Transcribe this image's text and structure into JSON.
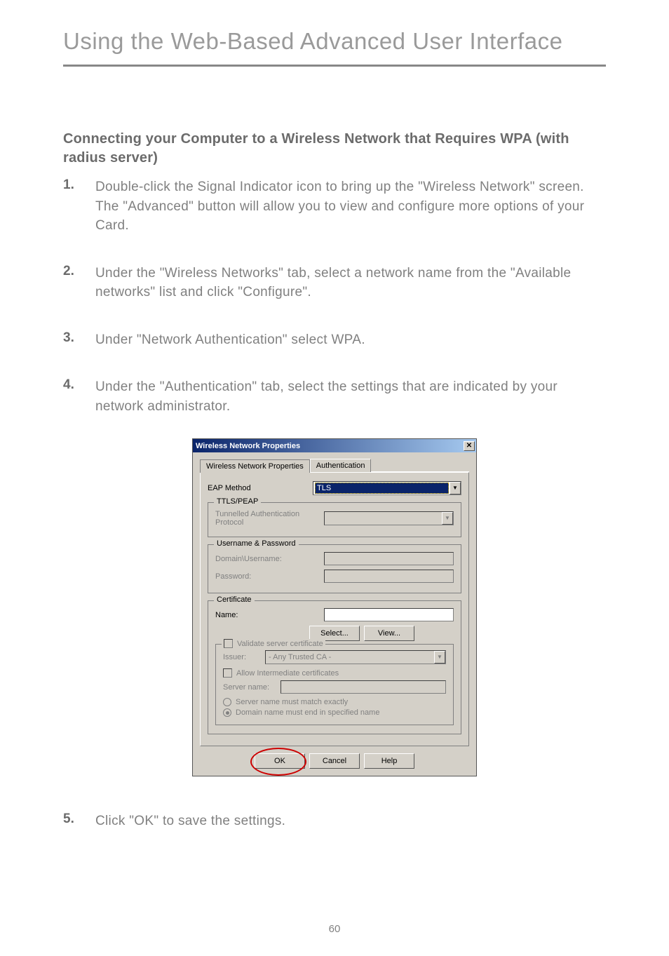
{
  "page": {
    "title": "Using the Web-Based Advanced User Interface",
    "number": "60"
  },
  "section_heading": "Connecting your Computer to a Wireless Network that Requires WPA (with radius server)",
  "steps": [
    {
      "num": "1.",
      "text": "Double-click the Signal Indicator icon to bring up the \"Wireless Network\" screen. The \"Advanced\" button will allow you to view and configure more options of your Card."
    },
    {
      "num": "2.",
      "text": "Under the \"Wireless Networks\" tab, select a network name from the \"Available networks\" list and click \"Configure\"."
    },
    {
      "num": "3.",
      "text": "Under \"Network Authentication\" select WPA."
    },
    {
      "num": "4.",
      "text": "Under the \"Authentication\" tab, select the settings that are indicated by your network administrator."
    },
    {
      "num": "5.",
      "text": "Click \"OK\" to save the settings."
    }
  ],
  "dialog": {
    "title": "Wireless Network Properties",
    "tabs": {
      "inactive": "Wireless Network Properties",
      "active": "Authentication"
    },
    "eap_method": {
      "label": "EAP Method",
      "value": "TLS"
    },
    "ttls_peap": {
      "legend": "TTLS/PEAP",
      "tunnelled": "Tunnelled Authentication Protocol"
    },
    "user_pass": {
      "legend": "Username & Password",
      "domain": "Domain\\Username:",
      "password": "Password:"
    },
    "certificate": {
      "legend": "Certificate",
      "name": "Name:",
      "select_btn": "Select...",
      "view_btn": "View...",
      "validate": "Validate server certificate",
      "issuer": "Issuer:",
      "issuer_val": "- Any Trusted CA -",
      "allow_intermediate": "Allow Intermediate certificates",
      "server_name": "Server name:",
      "opt_exact": "Server name must match exactly",
      "opt_domain": "Domain name must end in specified name"
    },
    "buttons": {
      "ok": "OK",
      "cancel": "Cancel",
      "help": "Help"
    }
  }
}
